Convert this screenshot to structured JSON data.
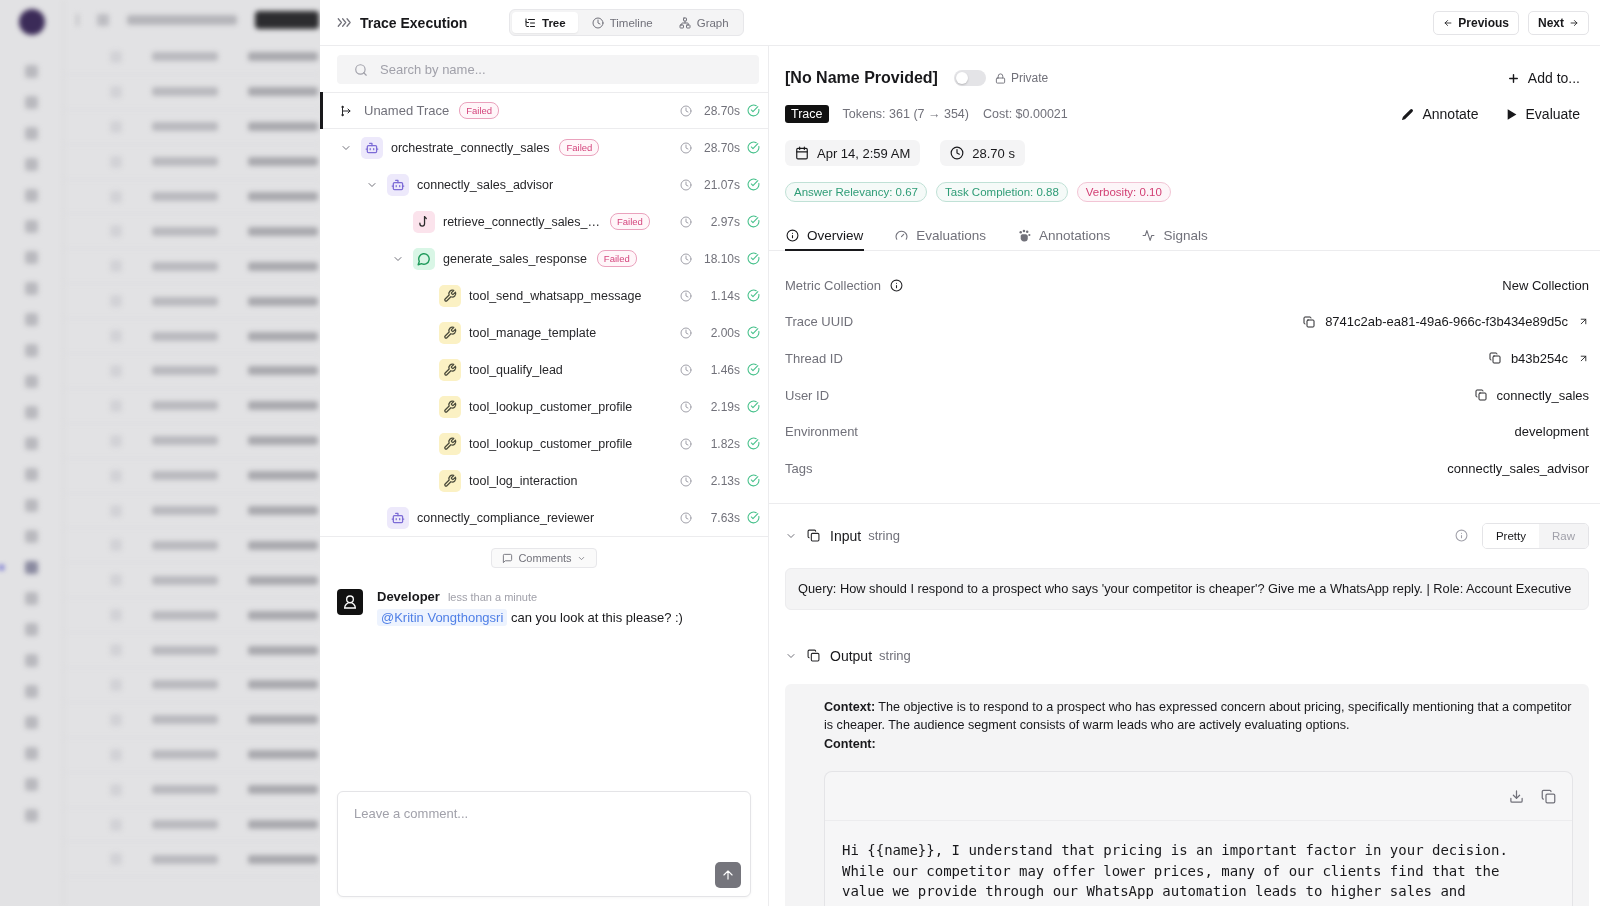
{
  "trace_panel": {
    "title": "Trace Execution",
    "view_tabs": [
      {
        "label": "Tree",
        "kind": "tree",
        "selected": true
      },
      {
        "label": "Timeline",
        "kind": "timeline",
        "selected": false
      },
      {
        "label": "Graph",
        "kind": "graph",
        "selected": false
      }
    ],
    "search": {
      "placeholder": "Search by name..."
    },
    "trace": {
      "name": "Unamed Trace",
      "badge": "Failed",
      "duration": "28.70s",
      "succeeded": true,
      "selected": true
    },
    "spans": [
      {
        "name": "orchestrate_connectly_sales",
        "kind": "agent",
        "badge": "Failed",
        "duration": "28.70s",
        "succeeded": true,
        "selected": false,
        "expanded": true,
        "children": [
          {
            "name": "connectly_sales_advisor",
            "kind": "agent",
            "duration": "21.07s",
            "succeeded": true,
            "selected": false,
            "expanded": true,
            "children": [
              {
                "name": "retrieve_connectly_sales_…",
                "kind": "retriever",
                "badge": "Failed",
                "duration": "2.97s",
                "succeeded": true,
                "selected": false
              },
              {
                "name": "generate_sales_response",
                "kind": "llm",
                "badge": "Failed",
                "duration": "18.10s",
                "succeeded": true,
                "selected": false,
                "expanded": true,
                "children": [
                  {
                    "name": "tool_send_whatsapp_message",
                    "kind": "tool",
                    "duration": "1.14s",
                    "succeeded": true,
                    "selected": false
                  },
                  {
                    "name": "tool_manage_template",
                    "kind": "tool",
                    "duration": "2.00s",
                    "succeeded": true,
                    "selected": false
                  },
                  {
                    "name": "tool_qualify_lead",
                    "kind": "tool",
                    "duration": "1.46s",
                    "succeeded": true,
                    "selected": false
                  },
                  {
                    "name": "tool_lookup_customer_profile",
                    "kind": "tool",
                    "duration": "2.19s",
                    "succeeded": true,
                    "selected": false
                  },
                  {
                    "name": "tool_lookup_customer_profile",
                    "kind": "tool",
                    "duration": "1.82s",
                    "succeeded": true,
                    "selected": false
                  },
                  {
                    "name": "tool_log_interaction",
                    "kind": "tool",
                    "duration": "2.13s",
                    "succeeded": true,
                    "selected": false
                  }
                ]
              }
            ]
          },
          {
            "name": "connectly_compliance_reviewer",
            "kind": "agent",
            "duration": "7.63s",
            "succeeded": true,
            "selected": false
          }
        ]
      }
    ],
    "comments_toggle": {
      "label": "Comments"
    },
    "comments": [
      {
        "author": "Developer",
        "time": "less than a minute",
        "mention": "@Kritin Vongthongsri",
        "text": "can you look at this please? :)"
      }
    ],
    "comment_box": {
      "placeholder": "Leave a comment..."
    }
  },
  "nav_buttons": [
    {
      "label": "Previous",
      "kind": "previous"
    },
    {
      "label": "Next",
      "kind": "next"
    }
  ],
  "detail": {
    "title": "[No Name Provided]",
    "private_toggle": {
      "label": "Private",
      "on": false
    },
    "add_button": "Add to...",
    "type_badge": "Trace",
    "tokens": "Tokens: 361 (7 → 354)",
    "cost": "Cost: $0.00021",
    "actions": [
      {
        "label": "Annotate",
        "kind": "annotate"
      },
      {
        "label": "Evaluate",
        "kind": "evaluate"
      }
    ],
    "timestamp": "Apr 14, 2:59 AM",
    "duration": "28.70 s",
    "metrics": [
      {
        "label": "Answer Relevancy: 0.67",
        "color": "#2e9c76"
      },
      {
        "label": "Task Completion: 0.88",
        "color": "#2e9c76"
      },
      {
        "label": "Verbosity: 0.10",
        "color": "#d23f73"
      }
    ],
    "tabs": [
      {
        "label": "Overview",
        "kind": "overview",
        "selected": true
      },
      {
        "label": "Evaluations",
        "kind": "evaluations",
        "selected": false
      },
      {
        "label": "Annotations",
        "kind": "annotations",
        "selected": false
      },
      {
        "label": "Signals",
        "kind": "signals",
        "selected": false
      }
    ],
    "properties": [
      {
        "label": "Metric Collection",
        "value": "New Collection",
        "info": true,
        "copyable": false,
        "linked": false
      },
      {
        "label": "Trace UUID",
        "value": "8741c2ab-ea81-49a6-966c-f3b434e89d5c",
        "info": false,
        "copyable": true,
        "linked": true
      },
      {
        "label": "Thread ID",
        "value": "b43b254c",
        "info": false,
        "copyable": true,
        "linked": true
      },
      {
        "label": "User ID",
        "value": "connectly_sales",
        "info": false,
        "copyable": true,
        "linked": false
      },
      {
        "label": "Environment",
        "value": "development",
        "info": false,
        "copyable": false,
        "linked": false
      },
      {
        "label": "Tags",
        "value": "connectly_sales_advisor",
        "info": false,
        "copyable": false,
        "linked": false
      }
    ],
    "input": {
      "title": "Input",
      "type": "string",
      "expanded": true,
      "formats": [
        {
          "label": "Pretty",
          "selected": true
        },
        {
          "label": "Raw",
          "selected": false
        }
      ],
      "text": "Query: How should I respond to a prospect who says 'your competitor is cheaper'? Give me a WhatsApp reply. | Role: Account Executive"
    },
    "output": {
      "title": "Output",
      "type": "string",
      "expanded": true,
      "context": "**Context:** The objective is to respond to a prospect who has expressed concern about pricing, specifically mentioning that a competitor is cheaper. The audience segment consists of warm leads who are actively evaluating options.",
      "content_label": "Content:",
      "code": "Hi {{name}}, I understand that pricing is an important factor in your decision.\nWhile our competitor may offer lower prices, many of our clients find that the\nvalue we provide through our WhatsApp automation leads to higher sales and"
    }
  }
}
